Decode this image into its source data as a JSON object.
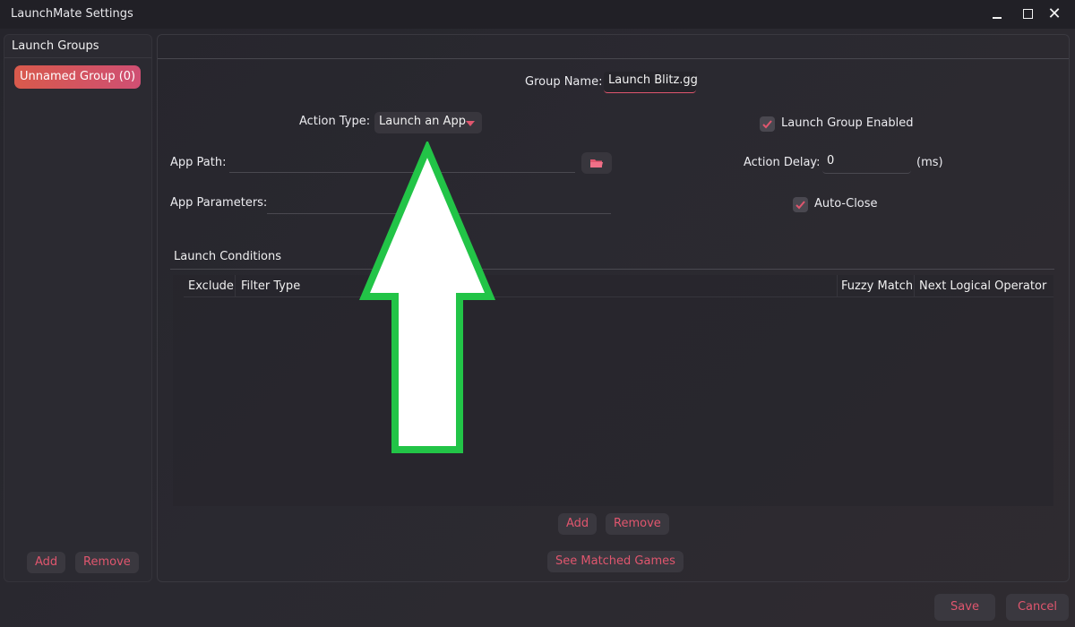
{
  "window": {
    "title": "LaunchMate Settings"
  },
  "sidebar": {
    "header": "Launch Groups",
    "items": [
      {
        "label": "Unnamed Group (0)"
      }
    ],
    "add_label": "Add",
    "remove_label": "Remove"
  },
  "form": {
    "group_name_label": "Group Name:",
    "group_name_value": "Launch Blitz.gg",
    "action_type_label": "Action Type:",
    "action_type_value": "Launch an App",
    "launch_group_enabled_label": "Launch Group Enabled",
    "launch_group_enabled_checked": true,
    "app_path_label": "App Path:",
    "app_path_value": "",
    "action_delay_label": "Action Delay:",
    "action_delay_value": "0",
    "action_delay_unit": "(ms)",
    "app_parameters_label": "App Parameters:",
    "app_parameters_value": "",
    "auto_close_label": "Auto-Close",
    "auto_close_checked": true
  },
  "conditions": {
    "title": "Launch Conditions",
    "columns": [
      "Exclude",
      "Filter Type",
      "Fuzzy Match",
      "Next Logical Operator"
    ],
    "rows": [],
    "add_label": "Add",
    "remove_label": "Remove",
    "see_matched_label": "See Matched Games"
  },
  "footer": {
    "save_label": "Save",
    "cancel_label": "Cancel"
  },
  "icons": {
    "folder": "folder-icon",
    "check": "checkmark-icon",
    "dropdown": "chevron-down-icon",
    "annotation": "up-arrow-icon"
  },
  "colors": {
    "accent": "#e0566e",
    "group_gradient_start": "#d85a4c",
    "group_gradient_end": "#cf4f73",
    "annotation_arrow_outline": "#22c447",
    "annotation_arrow_fill": "#ffffff"
  }
}
